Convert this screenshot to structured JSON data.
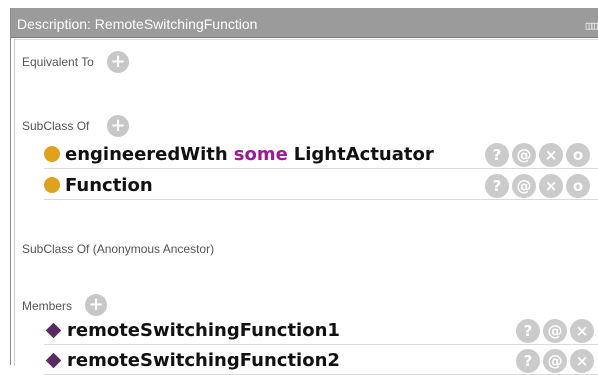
{
  "window": {
    "title": "Description: RemoteSwitchingFunction",
    "controls_icon": "window-controls-icon",
    "controls_glyph": "◫◫"
  },
  "sections": {
    "equivalent_to": "Equivalent To",
    "subclass_of": "SubClass Of",
    "anonymous_ancestor": "SubClass Of (Anonymous Ancestor)",
    "members": "Members"
  },
  "icons": {
    "add": "+",
    "help": "?",
    "annotate": "@",
    "delete": "×",
    "edit": "o"
  },
  "subclass_rows": [
    {
      "property": "engineeredWith",
      "keyword": "some",
      "filler": "LightActuator"
    },
    {
      "label": "Function"
    }
  ],
  "members": [
    {
      "label": "remoteSwitchingFunction1"
    },
    {
      "label": "remoteSwitchingFunction2"
    }
  ],
  "colors": {
    "titlebar": "#9b9b9b",
    "class_dot": "#e0a11f",
    "individual": "#5a2a62",
    "keyword": "#9a1a9a",
    "action_button": "#cbcbcb"
  }
}
